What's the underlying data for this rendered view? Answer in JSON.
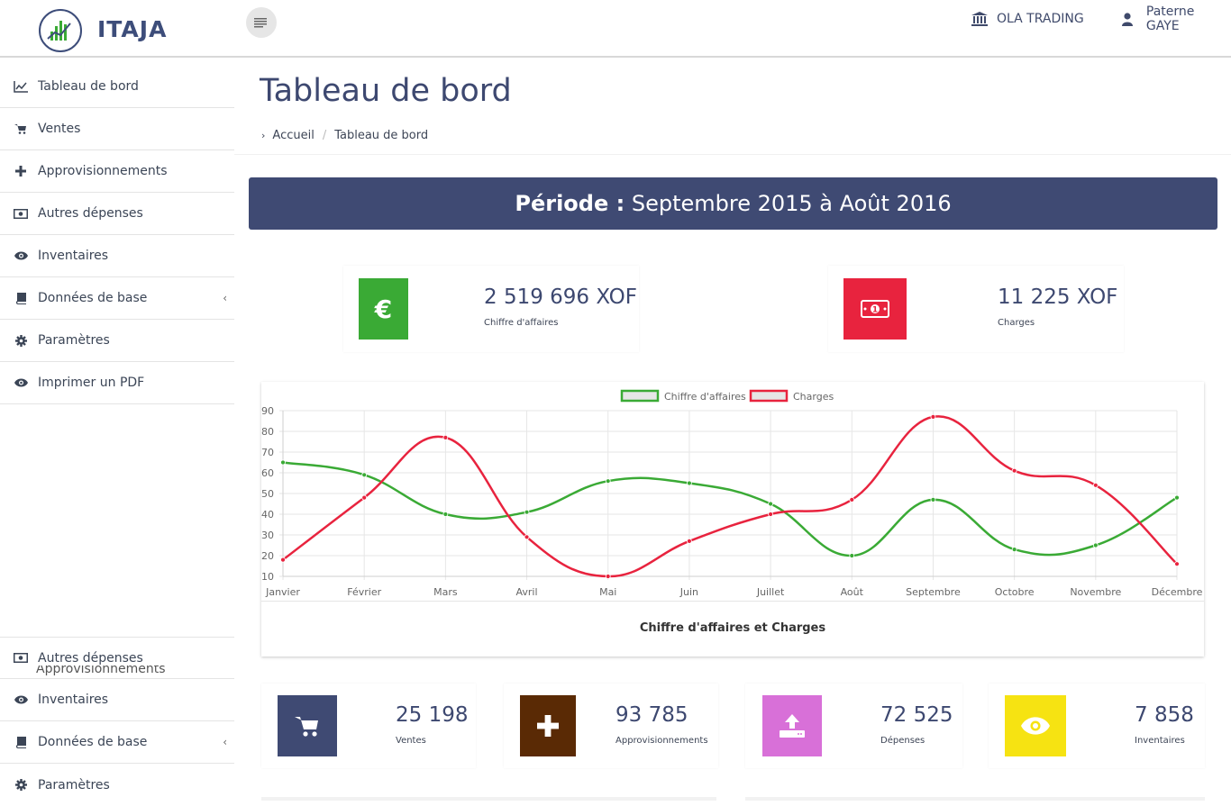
{
  "header": {
    "brand": "ITAJA",
    "company": "OLA TRADING",
    "user": "Paterne GAYE",
    "icons": {
      "company": "bank-icon",
      "user": "user-icon",
      "menu": "menu-toggle-icon"
    }
  },
  "sidebar": {
    "items": [
      {
        "label": "Tableau de bord",
        "icon": "line-chart-icon"
      },
      {
        "label": "Ventes",
        "icon": "cart-icon"
      },
      {
        "label": "Approvisionnements",
        "icon": "plus-icon"
      },
      {
        "label": "Autres dépenses",
        "icon": "money-icon"
      },
      {
        "label": "Inventaires",
        "icon": "eye-icon"
      },
      {
        "label": "Données de base",
        "icon": "book-icon",
        "has_submenu": true
      },
      {
        "label": "Paramètres",
        "icon": "gear-icon"
      },
      {
        "label": "Imprimer un PDF",
        "icon": "eye-icon"
      }
    ],
    "ghost_label": "Approvisionnements",
    "repeat_items": [
      {
        "label": "Autres dépenses",
        "icon": "money-icon"
      },
      {
        "label": "Inventaires",
        "icon": "eye-icon"
      },
      {
        "label": "Données de base",
        "icon": "book-icon",
        "has_submenu": true
      },
      {
        "label": "Paramètres",
        "icon": "gear-icon"
      }
    ]
  },
  "page": {
    "title": "Tableau de bord",
    "breadcrumb": {
      "home": "Accueil",
      "current": "Tableau de bord"
    },
    "period_label": "Période :",
    "period_value": "Septembre 2015 à Août 2016"
  },
  "kpis": [
    {
      "value": "2 519 696 XOF",
      "label": "Chiffre d'affaires",
      "color": "#3aaa35",
      "icon": "euro-icon"
    },
    {
      "value": "11 225 XOF",
      "label": "Charges",
      "color": "#e8233e",
      "icon": "money-icon"
    }
  ],
  "chart_data": {
    "type": "line",
    "categories": [
      "Janvier",
      "Février",
      "Mars",
      "Avril",
      "Mai",
      "Juin",
      "Juillet",
      "Août",
      "Septembre",
      "Octobre",
      "Novembre",
      "Décembre"
    ],
    "series": [
      {
        "name": "Chiffre d'affaires",
        "color": "#3aaa35",
        "values": [
          65,
          59,
          40,
          41,
          56,
          55,
          45,
          20,
          47,
          23,
          25,
          48
        ]
      },
      {
        "name": "Charges",
        "color": "#e8233e",
        "values": [
          18,
          48,
          77,
          29,
          10,
          27,
          40,
          47,
          87,
          61,
          54,
          16
        ]
      }
    ],
    "y_ticks": [
      10,
      20,
      30,
      40,
      50,
      60,
      70,
      80,
      90
    ],
    "ylim": [
      10,
      90
    ],
    "legend": "top-center",
    "grid": true,
    "caption": "Chiffre d'affaires et Charges"
  },
  "stats": [
    {
      "value": "25 198",
      "label": "Ventes",
      "color": "#3f4a73",
      "icon": "cart-icon"
    },
    {
      "value": "93 785",
      "label": "Approvisionnements",
      "color": "#5a2a05",
      "icon": "plus-icon"
    },
    {
      "value": "72 525",
      "label": "Dépenses",
      "color": "#d870d8",
      "icon": "upload-icon"
    },
    {
      "value": "7 858",
      "label": "Inventaires",
      "color": "#f6e312",
      "icon": "eye-icon"
    }
  ]
}
